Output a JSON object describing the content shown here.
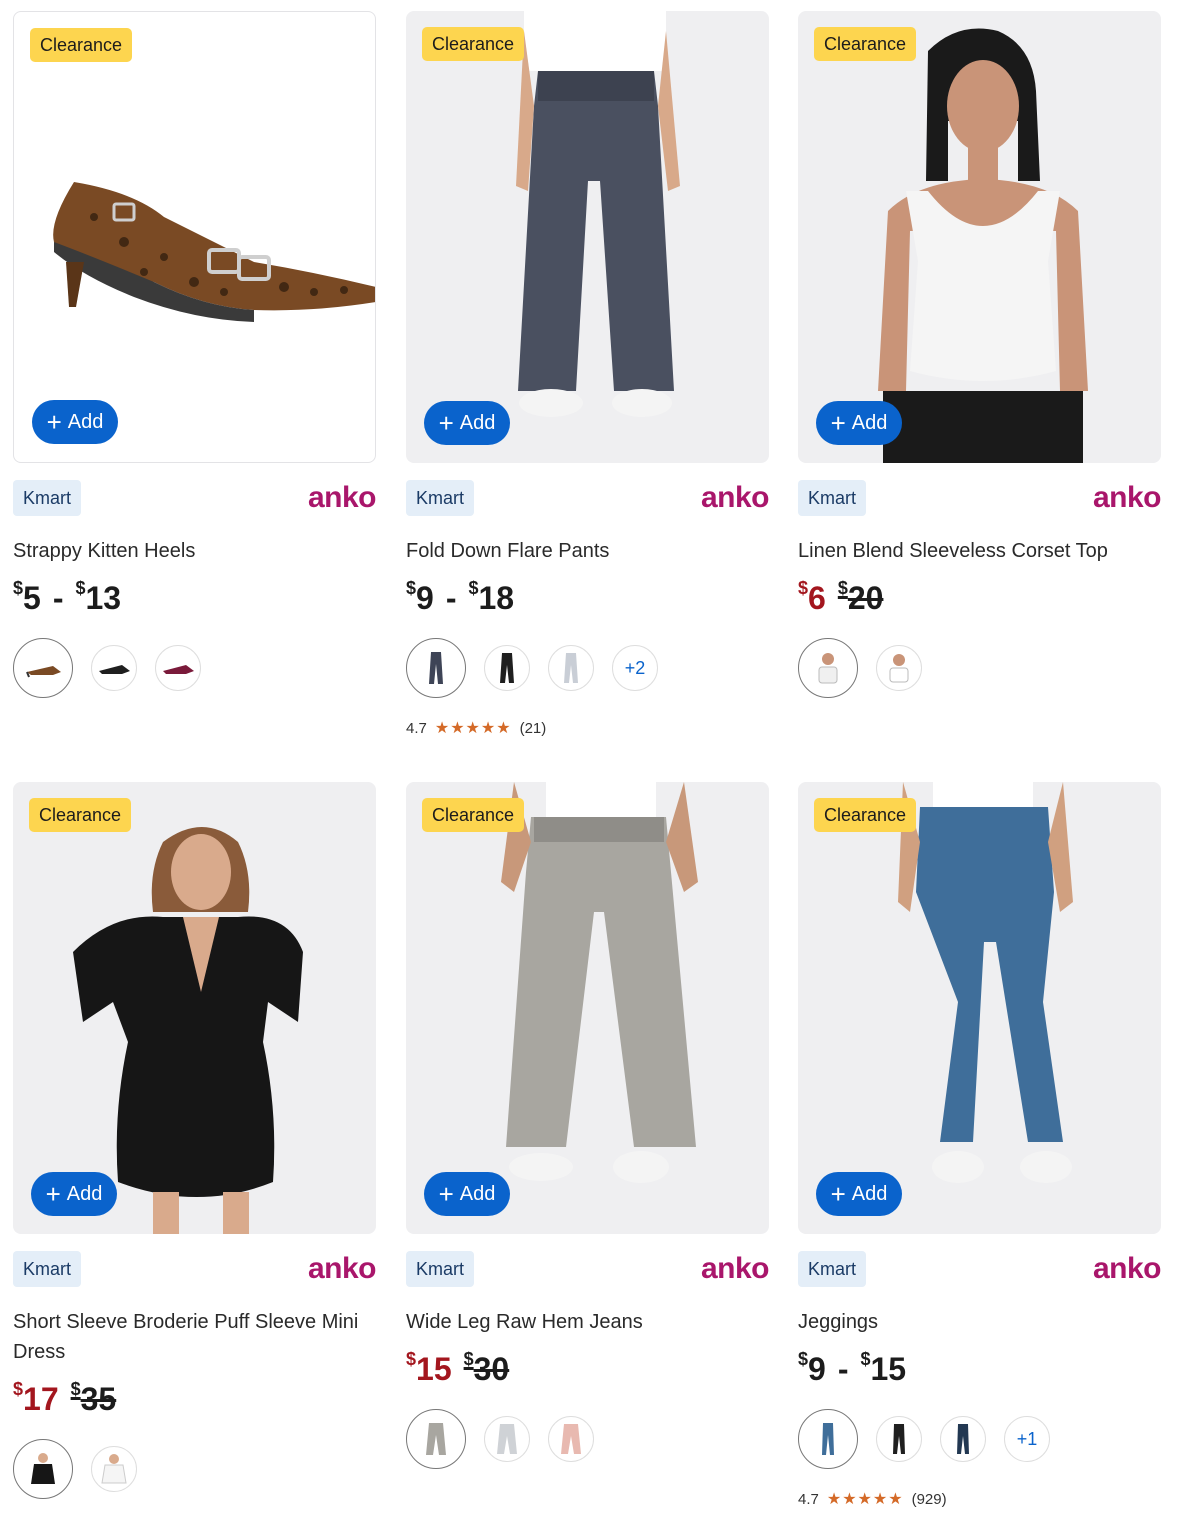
{
  "add_label": "Add",
  "clearance_label": "Clearance",
  "products": [
    {
      "store": "Kmart",
      "brand": "anko",
      "name": "Strappy Kitten Heels",
      "price": {
        "low": "5",
        "high": "13"
      },
      "swatches": [
        "leopard",
        "black",
        "pink"
      ],
      "more": "",
      "rating": null
    },
    {
      "store": "Kmart",
      "brand": "anko",
      "name": "Fold Down Flare Pants",
      "price": {
        "low": "9",
        "high": "18"
      },
      "swatches": [
        "charcoal",
        "black",
        "grey"
      ],
      "more": "+2",
      "rating": {
        "score": "4.7",
        "stars": "★★★★★",
        "count": "(21)"
      }
    },
    {
      "store": "Kmart",
      "brand": "anko",
      "name": "Linen Blend Sleeveless Corset Top",
      "price": {
        "sale": "6",
        "was": "20"
      },
      "swatches": [
        "white-dot",
        "white"
      ],
      "more": "",
      "rating": null
    },
    {
      "store": "Kmart",
      "brand": "anko",
      "name": "Short Sleeve Broderie Puff Sleeve Mini Dress",
      "price": {
        "sale": "17",
        "was": "35"
      },
      "swatches": [
        "black",
        "white"
      ],
      "more": "",
      "rating": null
    },
    {
      "store": "Kmart",
      "brand": "anko",
      "name": "Wide Leg Raw Hem Jeans",
      "price": {
        "sale": "15",
        "was": "30"
      },
      "swatches": [
        "grey",
        "light-grey",
        "pink"
      ],
      "more": "",
      "rating": null
    },
    {
      "store": "Kmart",
      "brand": "anko",
      "name": "Jeggings",
      "price": {
        "low": "9",
        "high": "15"
      },
      "swatches": [
        "mid-blue",
        "black",
        "dark-blue"
      ],
      "more": "+1",
      "rating": {
        "score": "4.7",
        "stars": "★★★★★",
        "count": "(929)"
      }
    }
  ],
  "colors": {
    "primary": "#0a63cc",
    "badge": "#fdd54f",
    "brand": "#a9166b",
    "sale": "#a3161e",
    "star": "#d46a28",
    "store_tag_bg": "#e4eef8"
  }
}
